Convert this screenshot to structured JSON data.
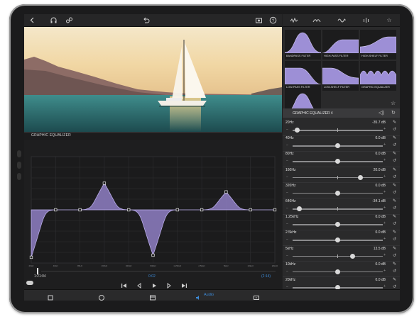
{
  "colors": {
    "accent": "#3d8bd8",
    "eq_fill": "#8f7fc4",
    "eq_stroke": "#b8abe8",
    "panel": "#2a2a2b",
    "chart_bg": "#1e1e1f"
  },
  "left_toolbar": {
    "icons": [
      "back-arrow-icon",
      "headphones-icon",
      "link-icon",
      "undo-icon",
      "camera-icon",
      "help-icon"
    ]
  },
  "eq_panel": {
    "label": "GRAPHIC EQUALIZER"
  },
  "eq_graph": {
    "nodes": [
      -10.3,
      -6.6,
      0.0,
      0.0,
      9.0,
      0.0,
      0.0,
      0.0,
      0.0,
      8.0,
      0.0,
      0.0,
      0.0,
      -9.5,
      0.0,
      0.0
    ],
    "points": [
      {
        "freq": "20Hz",
        "db": -35.7
      },
      {
        "freq": "40Hz",
        "db": 0.0
      },
      {
        "freq": "80Hz",
        "db": 0.0
      },
      {
        "freq": "160Hz",
        "db": 20.0
      },
      {
        "freq": "320Hz",
        "db": 0.0
      },
      {
        "freq": "640Hz",
        "db": -34.1
      },
      {
        "freq": "1.25kHz",
        "db": 0.0
      },
      {
        "freq": "2.5kHz",
        "db": 0.0
      },
      {
        "freq": "5kHz",
        "db": 13.5
      },
      {
        "freq": "10kHz",
        "db": 0.0
      },
      {
        "freq": "20kHz",
        "db": 0.0
      }
    ]
  },
  "timeline": {
    "playhead_time": "1:21:04",
    "center_readout": "0:02",
    "end_readout": "(2:14)"
  },
  "transport": {
    "icons": [
      "skip-to-start-icon",
      "step-back-icon",
      "play-icon",
      "step-forward-icon",
      "skip-to-end-icon"
    ]
  },
  "bottom_bar": {
    "active_tab": "Audio",
    "icons": [
      "crop-icon",
      "color-wheel-icon",
      "transform-icon",
      "audio-icon",
      "export-icon"
    ]
  },
  "right_tabs": {
    "icons": [
      "waveform-icon",
      "eq-curve-icon",
      "wave-icon",
      "spectrum-icon",
      "star-icon"
    ]
  },
  "presets": [
    {
      "name": "BANDPASS FILTER",
      "shape": "bandpass"
    },
    {
      "name": "HIGH-PASS FILTER",
      "shape": "highpass"
    },
    {
      "name": "HIGH-SHELF FILTER",
      "shape": "highshelf"
    },
    {
      "name": "LOW-PASS FILTER",
      "shape": "lowpass"
    },
    {
      "name": "LOW-SHELF FILTER",
      "shape": "lowshelf"
    },
    {
      "name": "GRAPHIC EQUALIZER",
      "shape": "graphic"
    },
    {
      "name": "",
      "shape": "bandpass"
    }
  ],
  "graphic_eq": {
    "title": "GRAPHIC EQUALIZER 4",
    "bands": [
      {
        "freq": "20Hz",
        "value": "-35.7 dB",
        "level": -35.7
      },
      {
        "freq": "40Hz",
        "value": "0.0 dB",
        "level": 0
      },
      {
        "freq": "80Hz",
        "value": "0.0 dB",
        "level": 0
      },
      {
        "freq": "160Hz",
        "value": "20.0 dB",
        "level": 20
      },
      {
        "freq": "320Hz",
        "value": "0.0 dB",
        "level": 0
      },
      {
        "freq": "640Hz",
        "value": "-34.1 dB",
        "level": -34.1
      },
      {
        "freq": "1.25kHz",
        "value": "0.0 dB",
        "level": 0
      },
      {
        "freq": "2.5kHz",
        "value": "0.0 dB",
        "level": 0
      },
      {
        "freq": "5kHz",
        "value": "13.5 dB",
        "level": 13.5
      },
      {
        "freq": "10kHz",
        "value": "0.0 dB",
        "level": 0
      },
      {
        "freq": "20kHz",
        "value": "0.0 dB",
        "level": 0
      }
    ]
  }
}
